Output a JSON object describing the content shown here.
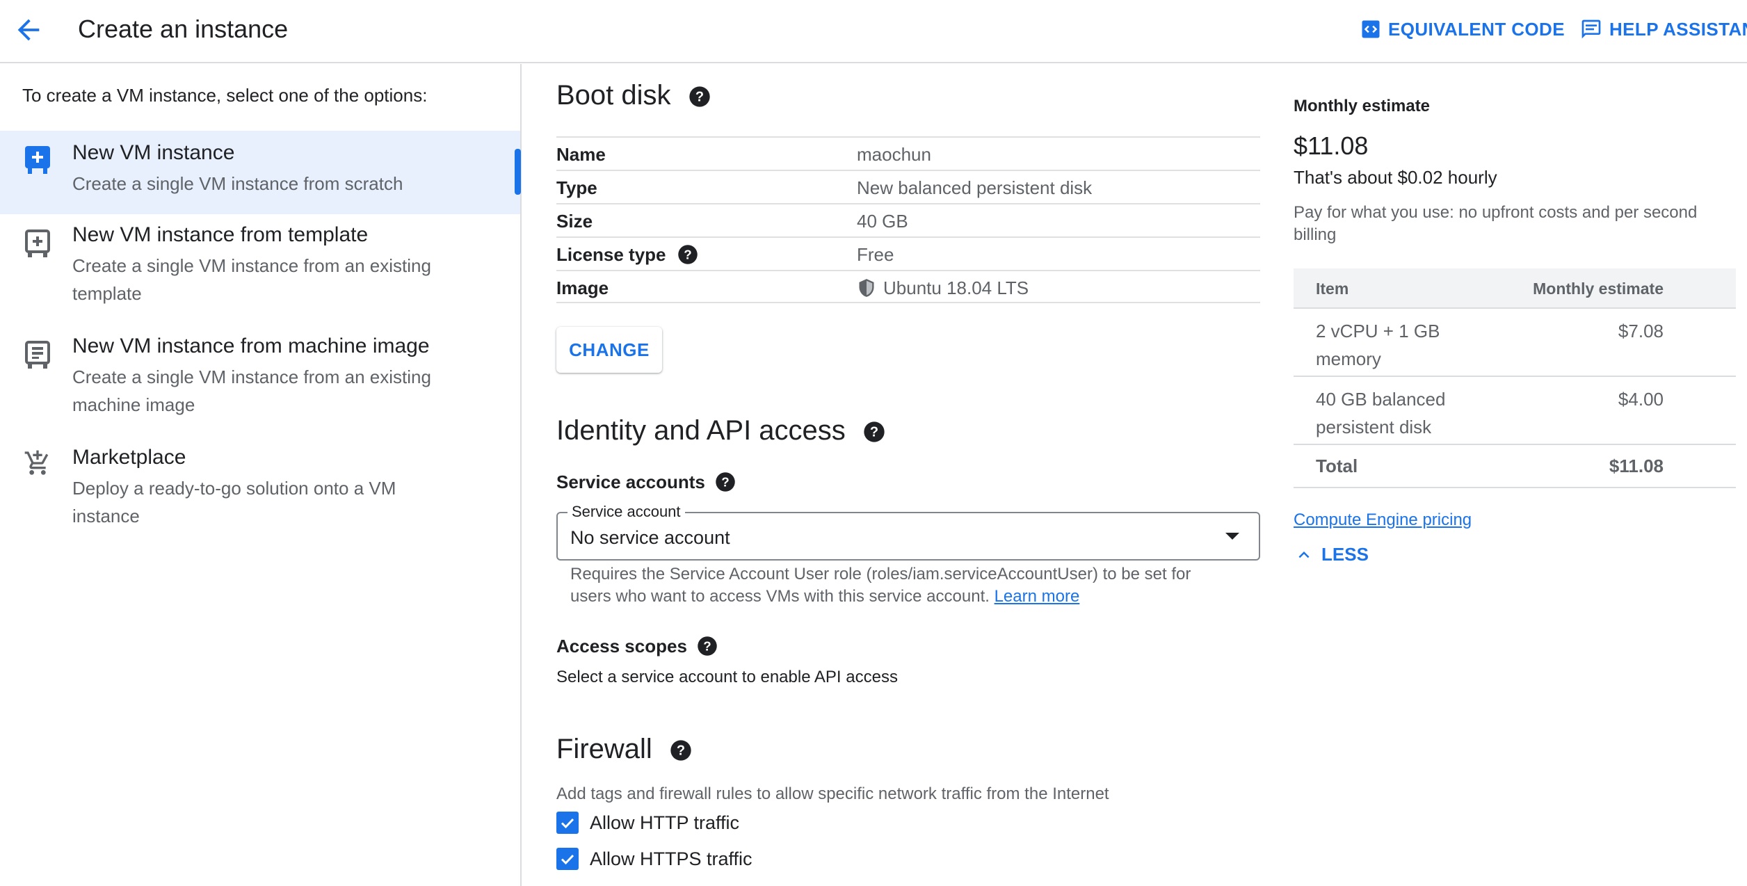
{
  "header": {
    "title": "Create an instance",
    "equivalent_code": "EQUIVALENT CODE",
    "help_assistant": "HELP ASSISTANT"
  },
  "left": {
    "intro": "To create a VM instance, select one of the options:",
    "options": [
      {
        "title": "New VM instance",
        "desc": "Create a single VM instance from scratch",
        "selected": true
      },
      {
        "title": "New VM instance from template",
        "desc": "Create a single VM instance from an existing template"
      },
      {
        "title": "New VM instance from machine image",
        "desc": "Create a single VM instance from an existing machine image"
      },
      {
        "title": "Marketplace",
        "desc": "Deploy a ready-to-go solution onto a VM instance"
      }
    ]
  },
  "boot_disk": {
    "heading": "Boot disk",
    "rows": [
      {
        "key": "Name",
        "value": "maochun"
      },
      {
        "key": "Type",
        "value": "New balanced persistent disk"
      },
      {
        "key": "Size",
        "value": "40 GB"
      },
      {
        "key": "License type",
        "value": "Free"
      },
      {
        "key": "Image",
        "value": "Ubuntu 18.04 LTS"
      }
    ],
    "change_label": "CHANGE"
  },
  "identity": {
    "heading": "Identity and API access",
    "service_accounts_label": "Service accounts",
    "select_label": "Service account",
    "select_value": "No service account",
    "hint": "Requires the Service Account User role (roles/iam.serviceAccountUser) to be set for users who want to access VMs with this service account.",
    "learn_more": "Learn more",
    "access_scopes_label": "Access scopes",
    "access_scopes_text": "Select a service account to enable API access"
  },
  "firewall": {
    "heading": "Firewall",
    "desc": "Add tags and firewall rules to allow specific network traffic from the Internet",
    "http_label": "Allow HTTP traffic",
    "http_checked": true,
    "https_label": "Allow HTTPS traffic",
    "https_checked": true
  },
  "estimate": {
    "heading": "Monthly estimate",
    "price": "$11.08",
    "hourly": "That's about $0.02 hourly",
    "note": "Pay for what you use: no upfront costs and per second billing",
    "col_item": "Item",
    "col_estimate": "Monthly estimate",
    "rows": [
      {
        "item": "2 vCPU + 1 GB memory",
        "value": "$7.08"
      },
      {
        "item": "40 GB balanced persistent disk",
        "value": "$4.00"
      }
    ],
    "total_label": "Total",
    "total_value": "$11.08",
    "pricing_link": "Compute Engine pricing",
    "less_label": "LESS"
  },
  "colors": {
    "accent": "#1a73e8",
    "selected_bg": "#e8f0fe",
    "divider": "#dadce0",
    "text_secondary": "#5f6368"
  },
  "icons": {
    "back": "arrow-left-icon",
    "code": "code-icon",
    "help_assistant": "chat-icon",
    "help": "question-circle-icon",
    "shield": "shield-icon",
    "checkbox": "check-icon",
    "less": "chevron-up-icon"
  }
}
